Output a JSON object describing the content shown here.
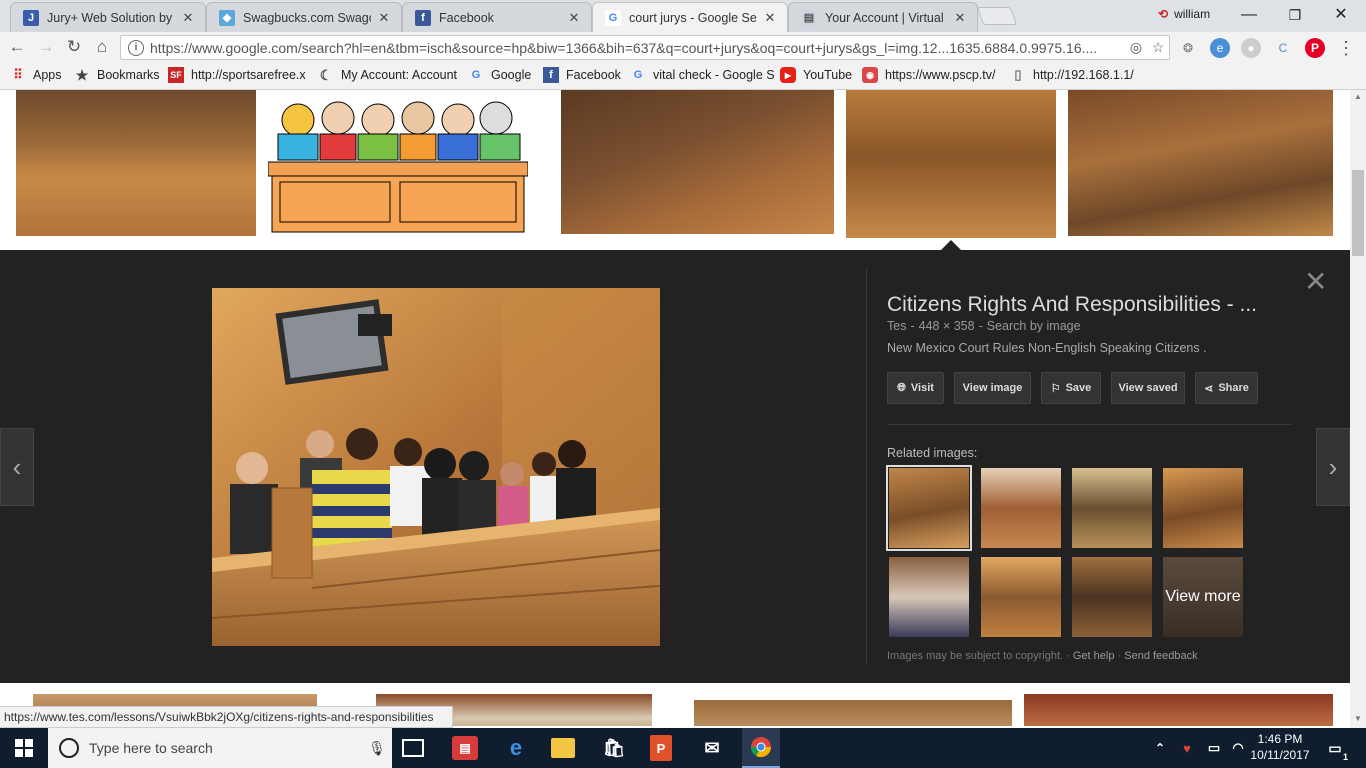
{
  "tabs": [
    {
      "title": "Jury+ Web Solution by Ju",
      "fav_color": "#3b5bab",
      "fav_glyph": "J"
    },
    {
      "title": "Swagbucks.com Swago. F",
      "fav_color": "#5aa7d9",
      "fav_glyph": "◆"
    },
    {
      "title": "Facebook",
      "fav_color": "#3b5998",
      "fav_glyph": "f"
    },
    {
      "title": "court jurys - Google Sear",
      "fav_color": "#ffffff",
      "fav_glyph": "G"
    },
    {
      "title": "Your Account | Virtual Re",
      "fav_color": "#9aa6b2",
      "fav_glyph": "▤"
    }
  ],
  "profile": {
    "name": "william"
  },
  "address": {
    "url": "https://www.google.com/search?hl=en&tbm=isch&source=hp&biw=1366&bih=637&q=court+jurys&oq=court+jurys&gs_l=img.12...1635.6884.0.9975.16....",
    "host": "www.google.com",
    "prefix": "https://"
  },
  "bookmarks": [
    {
      "label": "Apps",
      "icon": "apps-grid-icon"
    },
    {
      "label": "Bookmarks",
      "icon": "star-icon"
    },
    {
      "label": "http://sportsarefree.x",
      "icon": "sf-icon"
    },
    {
      "label": "My Account: Account",
      "icon": "swirl-icon"
    },
    {
      "label": "Google",
      "icon": "google-icon"
    },
    {
      "label": "Facebook",
      "icon": "facebook-icon"
    },
    {
      "label": "vital check - Google S",
      "icon": "google-icon"
    },
    {
      "label": "YouTube",
      "icon": "youtube-icon"
    },
    {
      "label": "https://www.pscp.tv/",
      "icon": "periscope-icon"
    },
    {
      "label": "http://192.168.1.1/",
      "icon": "page-icon"
    }
  ],
  "preview": {
    "title": "Citizens Rights And Responsibilities - ...",
    "source": "Tes",
    "dimensions": "448 × 358",
    "search_by_image": "Search by image",
    "description": "New Mexico Court Rules Non-English Speaking Citizens .",
    "buttons": {
      "visit": "Visit",
      "view_image": "View image",
      "save": "Save",
      "view_saved": "View saved",
      "share": "Share"
    },
    "related_label": "Related images:",
    "view_more": "View more",
    "copyright": "Images may be subject to copyright.",
    "get_help": "Get help",
    "send_feedback": "Send feedback"
  },
  "status_url": "https://www.tes.com/lessons/VsuiwkBbk2jOXg/citizens-rights-and-responsibilities",
  "taskbar": {
    "search_placeholder": "Type here to search",
    "time": "1:46 PM",
    "date": "10/11/2017",
    "notifications": "1"
  }
}
